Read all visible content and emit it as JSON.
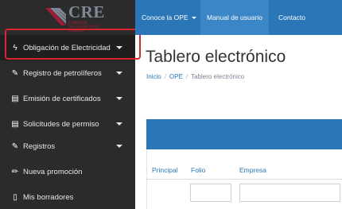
{
  "logo": {
    "text": "CRE",
    "subtext": "COMISIÓN REGULADORA DE ENERGÍA",
    "brand_color": "#7f8a96",
    "accent_color": "#a31c37"
  },
  "sidebar": {
    "items": [
      {
        "label": "Obligación de Electricidad",
        "icon": "bolt-icon",
        "glyph": "ϟ",
        "has_caret": true
      },
      {
        "label": "Registro de petrolíferos",
        "icon": "edit-icon",
        "glyph": "✎",
        "has_caret": true
      },
      {
        "label": "Emisión de certificados",
        "icon": "document-icon",
        "glyph": "▤",
        "has_caret": true
      },
      {
        "label": "Solicitudes de permiso",
        "icon": "document-icon",
        "glyph": "▤",
        "has_caret": true
      },
      {
        "label": "Registros",
        "icon": "edit-icon",
        "glyph": "✎",
        "has_caret": true
      },
      {
        "label": "Nueva promoción",
        "icon": "pencil-icon",
        "glyph": "✏",
        "has_caret": false
      },
      {
        "label": "Mis borradores",
        "icon": "file-icon",
        "glyph": "▯",
        "has_caret": false
      }
    ]
  },
  "topbar": {
    "links": [
      {
        "label": "Conoce la OPE",
        "has_caret": true
      },
      {
        "label": "Manual de usuario",
        "has_caret": false
      },
      {
        "label": "Contacto",
        "has_caret": false
      }
    ],
    "color": "#2a76b7"
  },
  "main": {
    "title": "Tablero electrónico",
    "breadcrumb": [
      "Inicio",
      "OPE",
      "Tablero electrónico"
    ],
    "table": {
      "columns": [
        "Principal",
        "Folio",
        "Empresa"
      ]
    }
  }
}
